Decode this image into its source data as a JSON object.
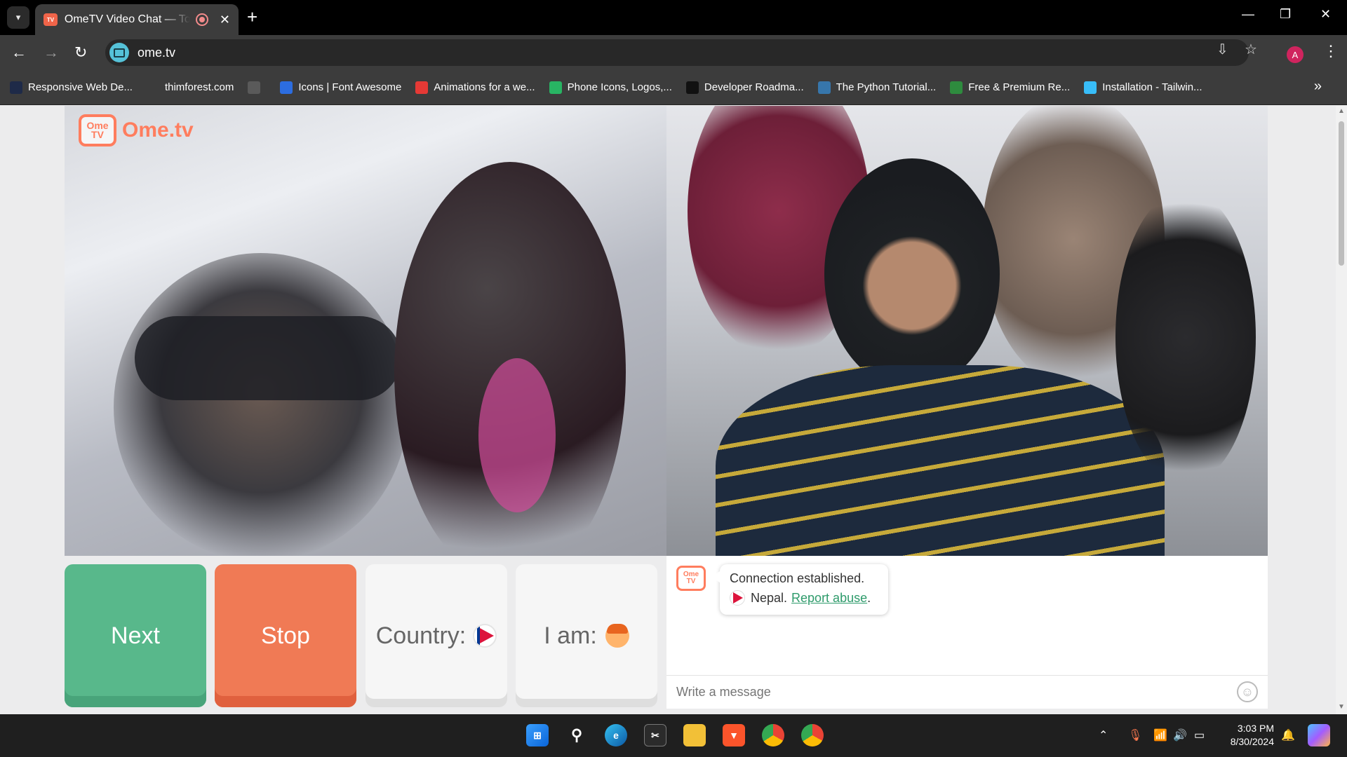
{
  "browser": {
    "tab_title": "OmeTV Video Chat — Top Chat Alternative",
    "url": "ome.tv",
    "profile_initial": "A"
  },
  "bookmarks": [
    {
      "label": "Responsive Web De...",
      "icon": "dev-logo-icon",
      "color": "#1e2a48"
    },
    {
      "label": "thimforest.com",
      "icon": "globe-icon",
      "color": "#3c3c3c"
    },
    {
      "label": "",
      "icon": "image-icon",
      "color": "#5a5a5a"
    },
    {
      "label": "Icons | Font Awesome",
      "icon": "flag-icon",
      "color": "#2c6de0"
    },
    {
      "label": "Animations for a we...",
      "icon": "flame-icon",
      "color": "#e53935"
    },
    {
      "label": "Phone Icons, Logos,...",
      "icon": "grid-icon",
      "color": "#28b463"
    },
    {
      "label": "Developer Roadma...",
      "icon": "roadmap-icon",
      "color": "#111111"
    },
    {
      "label": "The Python Tutorial...",
      "icon": "python-icon",
      "color": "#3776ab"
    },
    {
      "label": "Free & Premium Re...",
      "icon": "leaf-icon",
      "color": "#2e8b3e"
    },
    {
      "label": "Installation - Tailwin...",
      "icon": "tailwind-icon",
      "color": "#38bdf8"
    }
  ],
  "app": {
    "logo_badge": "Ome TV",
    "logo_text": "Ome.tv"
  },
  "controls": {
    "next_label": "Next",
    "stop_label": "Stop",
    "country_label": "Country:",
    "iam_label": "I am:"
  },
  "chat": {
    "status": "Connection established.",
    "country": "Nepal.",
    "report_label": "Report abuse",
    "report_suffix": ".",
    "placeholder": "Write a message"
  },
  "taskbar": {
    "time": "3:03 PM",
    "date": "8/30/2024"
  },
  "colors": {
    "next": "#58b88b",
    "stop": "#f07a55",
    "brand": "#ff7d5e",
    "link": "#2e9b6b"
  }
}
